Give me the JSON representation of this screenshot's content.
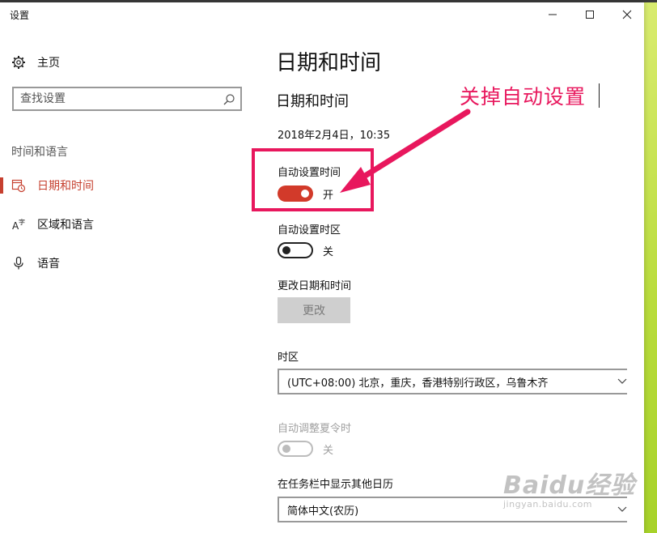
{
  "window": {
    "title": "设置",
    "controls": {
      "minimize": "—",
      "maximize": "☐",
      "close": "✕"
    }
  },
  "sidebar": {
    "home_label": "主页",
    "search": {
      "placeholder": "查找设置",
      "value": ""
    },
    "section_label": "时间和语言",
    "items": [
      {
        "label": "日期和时间",
        "icon": "calendar-clock-icon",
        "active": true
      },
      {
        "label": "区域和语言",
        "icon": "language-icon",
        "active": false
      },
      {
        "label": "语音",
        "icon": "microphone-icon",
        "active": false
      }
    ]
  },
  "main": {
    "page_title": "日期和时间",
    "subtitle": "日期和时间",
    "current_datetime": "2018年2月4日，10:35",
    "auto_time": {
      "label": "自动设置时间",
      "state": "开",
      "on": true
    },
    "auto_timezone": {
      "label": "自动设置时区",
      "state": "关",
      "on": false
    },
    "change_datetime": {
      "label": "更改日期和时间",
      "button": "更改",
      "enabled": false
    },
    "timezone": {
      "label": "时区",
      "value": "(UTC+08:00) 北京，重庆，香港特别行政区，乌鲁木齐"
    },
    "dst": {
      "label": "自动调整夏令时",
      "state": "关",
      "enabled": false
    },
    "extra_calendar": {
      "label": "在任务栏中显示其他日历",
      "value": "简体中文(农历)"
    }
  },
  "annotation": {
    "text": "关掉自动设置",
    "color": "#e8175d"
  },
  "watermark": {
    "logo": "Baidu经验",
    "url": "jingyan.baidu.com"
  },
  "colors": {
    "accent": "#c6402f",
    "toggle_on": "#d23a2a",
    "annotation": "#e8175d"
  }
}
